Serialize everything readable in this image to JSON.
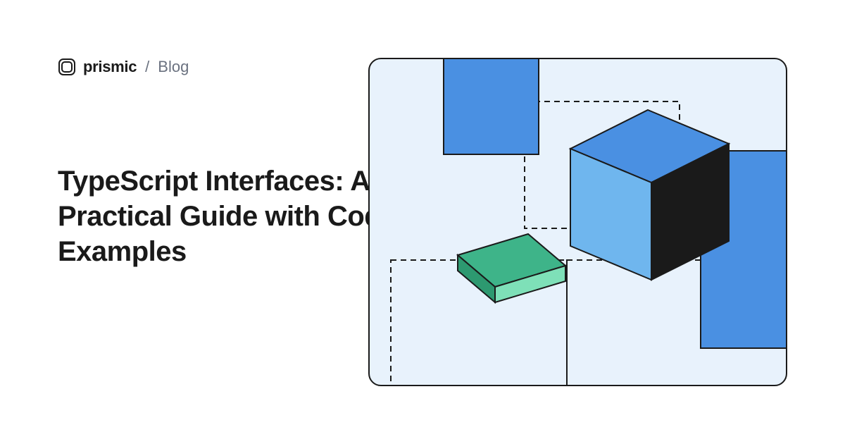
{
  "header": {
    "brand": "prismic",
    "separator": "/",
    "section": "Blog"
  },
  "title": "TypeScript Interfaces: A Practical Guide with Code Examples",
  "colors": {
    "blue_light": "#6fb6ee",
    "blue_medium": "#4a90e2",
    "blue_dark": "#3b7dd8",
    "green_top": "#3eb489",
    "green_side": "#5fd4a8",
    "dark": "#1a1a1a",
    "bg_light": "#e8f2fc"
  }
}
